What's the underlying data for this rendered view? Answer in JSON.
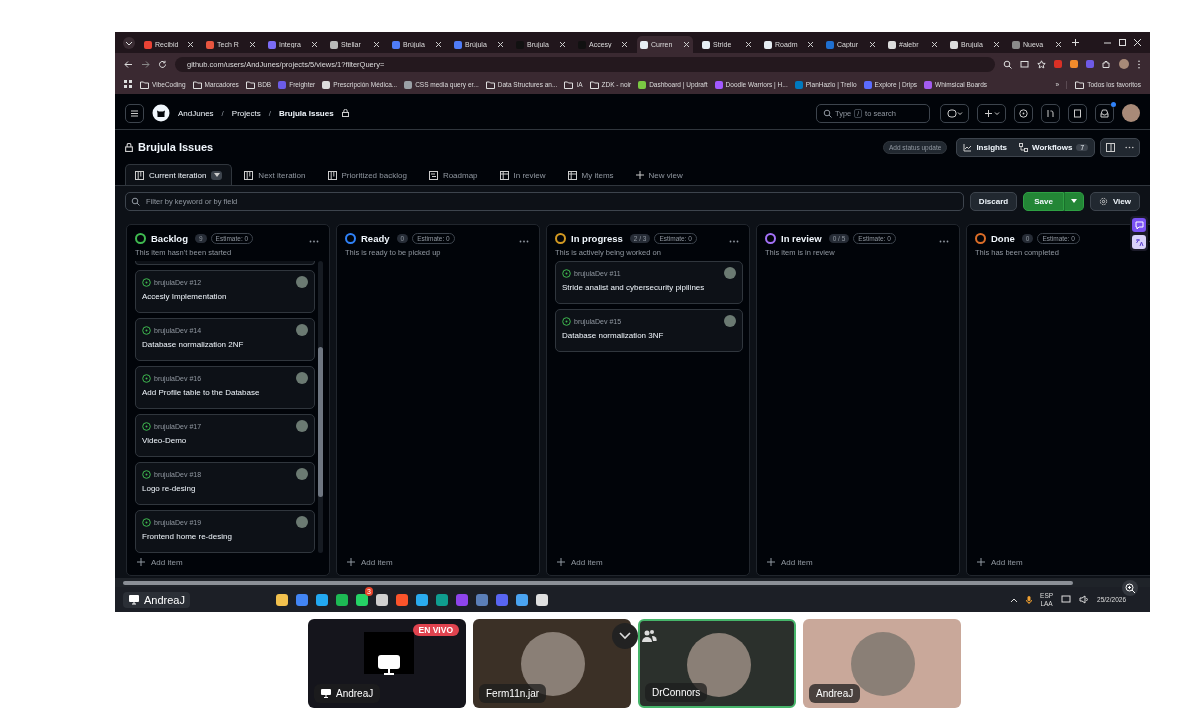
{
  "browser": {
    "tabs": [
      {
        "label": "Recibid",
        "selected": false,
        "color": "#ea4335"
      },
      {
        "label": "Tech R",
        "selected": false,
        "color": "#e8553f"
      },
      {
        "label": "Integra",
        "selected": false,
        "color": "#7b6cf6"
      },
      {
        "label": "Stellar",
        "selected": false,
        "color": "#b9b9b9"
      },
      {
        "label": "Brújula",
        "selected": false,
        "color": "#4f7cf7"
      },
      {
        "label": "Brújula",
        "selected": false,
        "color": "#4f7cf7"
      },
      {
        "label": "Brujula",
        "selected": false,
        "color": "#111111"
      },
      {
        "label": "Accesy",
        "selected": false,
        "color": "#111111"
      },
      {
        "label": "Curren",
        "selected": true,
        "color": "#e6edf3"
      },
      {
        "label": "Stride",
        "selected": false,
        "color": "#e6edf3"
      },
      {
        "label": "Roadm",
        "selected": false,
        "color": "#e6edf3"
      },
      {
        "label": "Captur",
        "selected": false,
        "color": "#1f6fd0"
      },
      {
        "label": "#alebr",
        "selected": false,
        "color": "#dddddd"
      },
      {
        "label": "Brujula",
        "selected": false,
        "color": "#dddddd"
      },
      {
        "label": "Nueva",
        "selected": false,
        "color": "#8a8a8a"
      }
    ],
    "url": "github.com/users/AndJunes/projects/5/views/1?filterQuery=",
    "bookmarks": [
      {
        "kind": "folder",
        "label": "VibeCoding"
      },
      {
        "kind": "folder",
        "label": "Marcadores"
      },
      {
        "kind": "folder",
        "label": "BDB"
      },
      {
        "kind": "site",
        "label": "Freighter",
        "color": "#6c5ce7"
      },
      {
        "kind": "site",
        "label": "Prescripción Médica...",
        "color": "#dcdcdc"
      },
      {
        "kind": "site",
        "label": "CSS media query er...",
        "color": "#9aa0a6"
      },
      {
        "kind": "folder",
        "label": "Data Structures an..."
      },
      {
        "kind": "folder",
        "label": "IA"
      },
      {
        "kind": "folder",
        "label": "ZDK - noir"
      },
      {
        "kind": "site",
        "label": "Dashboard | Updraft",
        "color": "#7ac943"
      },
      {
        "kind": "site",
        "label": "Doodle Warriors | H...",
        "color": "#a259ff"
      },
      {
        "kind": "site",
        "label": "PlanHazlo | Trello",
        "color": "#0079bf"
      },
      {
        "kind": "site",
        "label": "Explore | Drips",
        "color": "#5b6cff"
      },
      {
        "kind": "site",
        "label": "Whimsical Boards",
        "color": "#a35cf0"
      }
    ],
    "overflow": "»",
    "all_bookmarks": "Todos los favoritos"
  },
  "github": {
    "breadcrumb": [
      "AndJunes",
      "Projects",
      "Brujula Issues"
    ],
    "separator": "/",
    "search": {
      "prefix": "Type",
      "key": "/",
      "suffix": "to search"
    }
  },
  "project": {
    "title": "Brujula Issues",
    "status_button": "Add status update",
    "insights": "Insights",
    "workflows": "Workflows",
    "workflows_count": "7"
  },
  "views": [
    {
      "label": "Current iteration",
      "kind": "board",
      "selected": true
    },
    {
      "label": "Next iteration",
      "kind": "board",
      "selected": false
    },
    {
      "label": "Prioritized backlog",
      "kind": "board",
      "selected": false
    },
    {
      "label": "Roadmap",
      "kind": "roadmap",
      "selected": false
    },
    {
      "label": "In review",
      "kind": "table",
      "selected": false
    },
    {
      "label": "My items",
      "kind": "table",
      "selected": false
    }
  ],
  "new_view": "New view",
  "filter": {
    "placeholder": "Filter by keyword or by field"
  },
  "actions": {
    "discard": "Discard",
    "save": "Save",
    "view": "View"
  },
  "columns": [
    {
      "name": "Backlog",
      "count": "9",
      "estimate": "Estimate: 0",
      "description": "This item hasn't been started",
      "color": "#3fb950",
      "cut_card_above": true,
      "add": "Add item",
      "cards": [
        {
          "ref": "brujulaDev #12",
          "title": "Accesly Implementation"
        },
        {
          "ref": "brujulaDev #14",
          "title": "Database normalization 2NF"
        },
        {
          "ref": "brujulaDev #16",
          "title": "Add Profile table to the Database"
        },
        {
          "ref": "brujulaDev #17",
          "title": "Video-Demo"
        },
        {
          "ref": "brujulaDev #18",
          "title": "Logo re-desing"
        },
        {
          "ref": "brujulaDev #19",
          "title": "Frontend home re-desing"
        }
      ]
    },
    {
      "name": "Ready",
      "count": "0",
      "estimate": "Estimate: 0",
      "description": "This is ready to be picked up",
      "color": "#2f81f7",
      "cut_card_above": false,
      "add": "Add item"
    },
    {
      "name": "In progress",
      "count": "2 / 3",
      "estimate": "Estimate: 0",
      "description": "This is actively being worked on",
      "color": "#d29922",
      "cut_card_above": false,
      "add": "Add item",
      "cards": [
        {
          "ref": "brujulaDev #11",
          "title": "Stride analist and cybersecurity pipilines"
        },
        {
          "ref": "brujulaDev #15",
          "title": "Database normalization 3NF"
        }
      ]
    },
    {
      "name": "In review",
      "count": "0 / 5",
      "estimate": "Estimate: 0",
      "description": "This item is in review",
      "color": "#a371f7",
      "cut_card_above": false,
      "add": "Add item"
    },
    {
      "name": "Done",
      "count": "0",
      "estimate": "Estimate: 0",
      "description": "This has been completed",
      "color": "#db6d28",
      "cut_card_above": false,
      "add": "Add item"
    }
  ],
  "taskbar": {
    "presenter": "AndreaJ",
    "apps": [
      {
        "color": "#f2c14e"
      },
      {
        "color": "#4285f4"
      },
      {
        "color": "#23a9f2"
      },
      {
        "color": "#1db954"
      },
      {
        "color": "#25d366",
        "badge": "3"
      },
      {
        "color": "#cfcfcf"
      },
      {
        "color": "#fb542b"
      },
      {
        "color": "#2aabee"
      },
      {
        "color": "#0f9d8f"
      },
      {
        "color": "#8e44ec"
      },
      {
        "color": "#5b7fb8"
      },
      {
        "color": "#5865f2"
      },
      {
        "color": "#4aa3f0"
      },
      {
        "color": "#e0e0e0"
      }
    ],
    "lang": "ESP",
    "layout": "LAA",
    "date": "25/2/2026"
  },
  "call": {
    "tiles": [
      {
        "kind": "screen",
        "name": "AndreaJ",
        "badge": "EN VIVO",
        "speaking": false,
        "color": "#15151c"
      },
      {
        "kind": "person",
        "name": "Ferm11n.jar",
        "speaking": false,
        "color": "#3b3026"
      },
      {
        "kind": "person",
        "name": "DrConnors",
        "speaking": true,
        "color": "#2b302c"
      },
      {
        "kind": "person",
        "name": "AndreaJ",
        "speaking": false,
        "color": "#c9a89a"
      }
    ]
  }
}
